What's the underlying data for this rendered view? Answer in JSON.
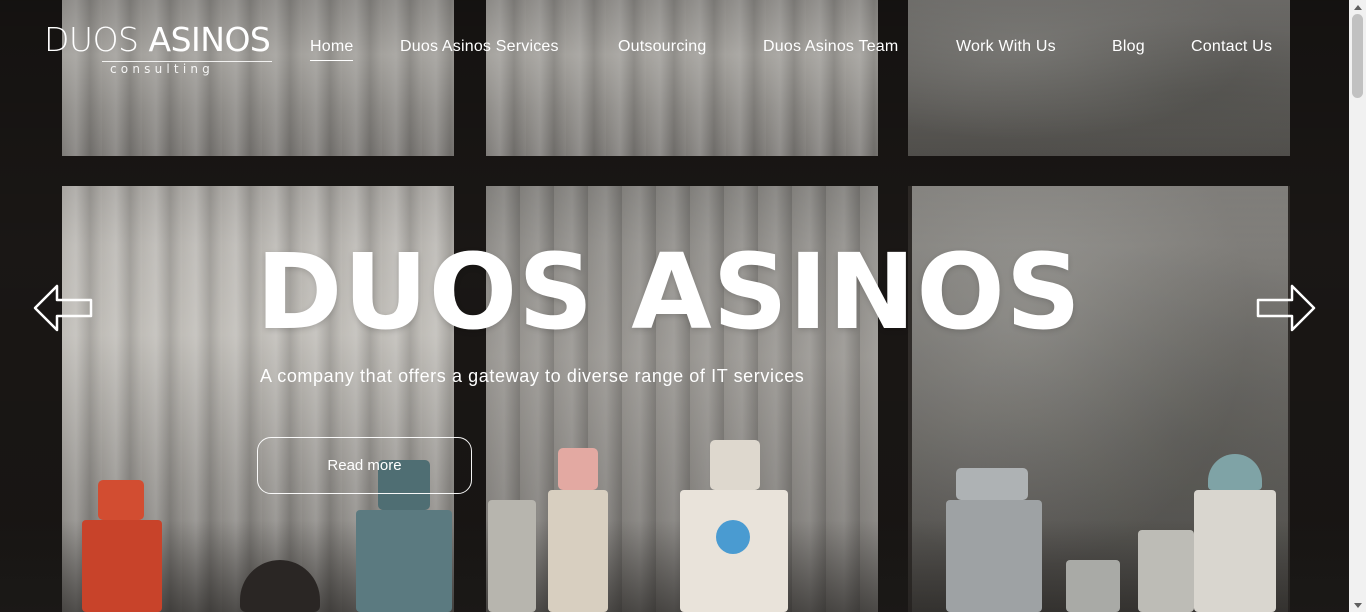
{
  "logo": {
    "wordmark_left": "DUOS",
    "wordmark_right": "ASINOS",
    "tagline": "consulting"
  },
  "nav": {
    "items": [
      {
        "label": "Home",
        "active": true
      },
      {
        "label": "Duos Asinos Services",
        "active": false
      },
      {
        "label": "Outsourcing",
        "active": false
      },
      {
        "label": "Duos Asinos Team",
        "active": false
      },
      {
        "label": "Work With Us",
        "active": false
      },
      {
        "label": "Blog",
        "active": false
      },
      {
        "label": "Contact Us",
        "active": false
      }
    ]
  },
  "hero": {
    "title": "DUOS ASINOS",
    "subtitle": "A company that offers a gateway to diverse range of IT services",
    "cta_label": "Read more"
  },
  "slider": {
    "prev_icon": "arrow-left-icon",
    "next_icon": "arrow-right-icon"
  },
  "colors": {
    "text": "#ffffff",
    "frame": "#1b1816",
    "scrollbar_track": "#f1f1f1",
    "scrollbar_thumb": "#c1c1c1"
  }
}
